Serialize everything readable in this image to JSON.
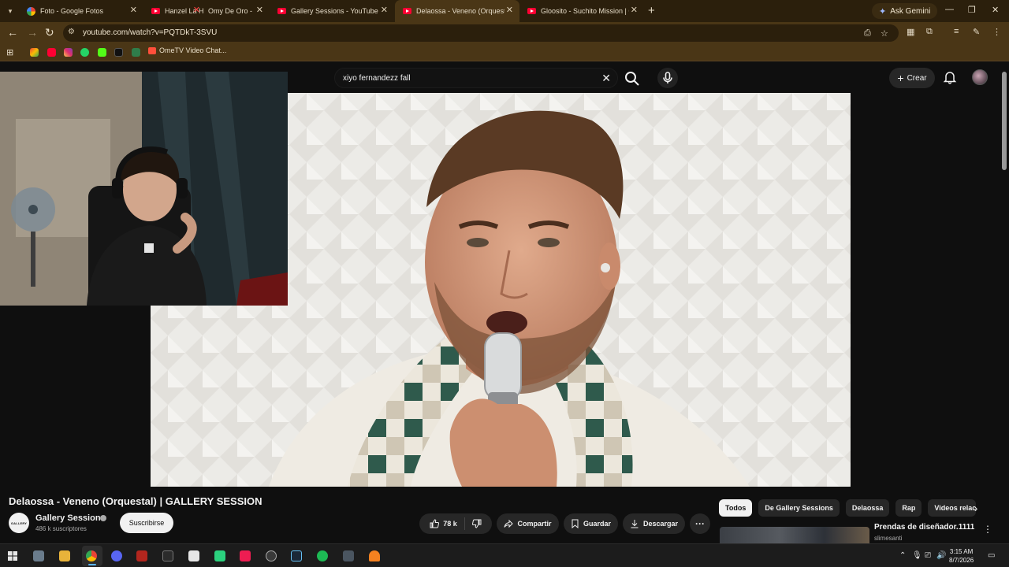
{
  "browser": {
    "tabs": [
      {
        "title": "Foto - Google Fotos",
        "favicon": "google-photos-icon",
        "active": false
      },
      {
        "title": "Hanzel La H",
        "favicon": "youtube-icon",
        "active": false
      },
      {
        "title": "Omy De Oro -",
        "favicon": "youtube-icon",
        "active": false
      },
      {
        "title": "Gallery Sessions - YouTube",
        "favicon": "youtube-icon",
        "active": false
      },
      {
        "title": "Delaossa - Veneno (Orquestal) |",
        "favicon": "youtube-icon",
        "active": true
      },
      {
        "title": "Gloosito - Suchito Mission | GA",
        "favicon": "youtube-icon",
        "active": false
      }
    ],
    "ask_gemini": "Ask Gemini",
    "url": "youtube.com/watch?v=PQTDkT-3SVU",
    "bookmarks": {
      "ometv": "OmeTV Video Chat..."
    },
    "accent_color": "#4a3616"
  },
  "youtube": {
    "search_value": "xiyo fernandezz fall",
    "create_label": "Crear",
    "video_title": "Delaossa - Veneno (Orquestal) | GALLERY SESSION",
    "channel": {
      "logo_text": "GALLERY",
      "name": "Gallery Sessions",
      "subscribers": "486 k suscriptores",
      "subscribe_label": "Suscribirse"
    },
    "actions": {
      "likes": "78 k",
      "share": "Compartir",
      "save": "Guardar",
      "download": "Descargar"
    },
    "chips": [
      "Todos",
      "De Gallery Sessions",
      "Delaossa",
      "Rap",
      "Videos relac"
    ],
    "recommendation": {
      "title": "Prendas de diseñador.1111",
      "channel": "slimesanti"
    }
  },
  "taskbar": {
    "time": "3:15 AM",
    "date": "8/7/2026"
  }
}
